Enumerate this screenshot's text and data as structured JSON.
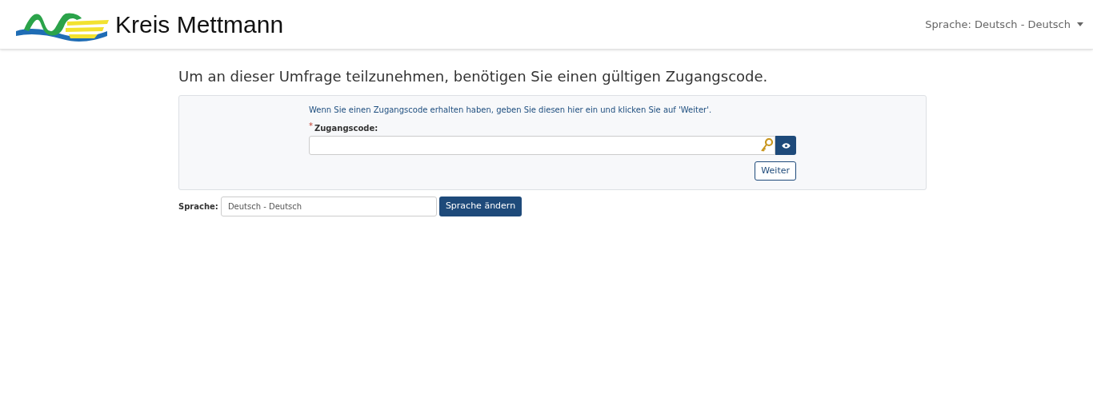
{
  "header": {
    "logo_text": "Kreis Mettmann",
    "language_menu": "Sprache: Deutsch - Deutsch"
  },
  "title": "Um an dieser Umfrage teilzunehmen, benötigen Sie einen gültigen Zugangscode.",
  "form": {
    "hint": "Wenn Sie einen Zugangscode erhalten haben, geben Sie diesen hier ein und klicken Sie auf 'Weiter'.",
    "required_mark": "*",
    "label": "Zugangscode:",
    "submit": "Weiter"
  },
  "language": {
    "label": "Sprache:",
    "value": "Deutsch - Deutsch",
    "button": "Sprache ändern"
  }
}
